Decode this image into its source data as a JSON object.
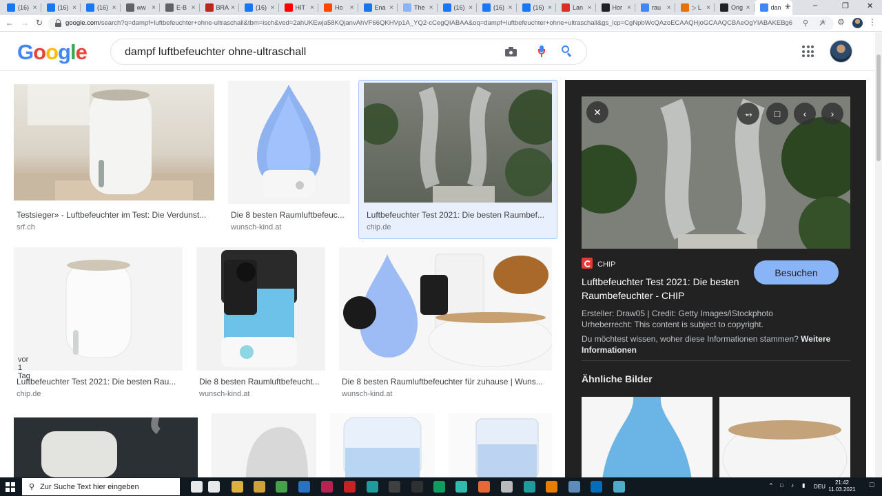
{
  "browser": {
    "tabs": [
      {
        "title": "(16)",
        "icon": "facebook-icon",
        "color": "#1877f2"
      },
      {
        "title": "(16)",
        "icon": "facebook-icon",
        "color": "#1877f2"
      },
      {
        "title": "(16)",
        "icon": "facebook-icon",
        "color": "#1877f2"
      },
      {
        "title": "ww",
        "icon": "globe-icon",
        "color": "#5f6368"
      },
      {
        "title": "E-B",
        "icon": "gear-icon",
        "color": "#5f6368"
      },
      {
        "title": "BRA",
        "icon": "brand-b-icon",
        "color": "#c5221f"
      },
      {
        "title": "(16)",
        "icon": "facebook-icon",
        "color": "#1877f2"
      },
      {
        "title": "HIT",
        "icon": "youtube-icon",
        "color": "#ff0000"
      },
      {
        "title": "Ho",
        "icon": "reddit-icon",
        "color": "#ff4500"
      },
      {
        "title": "Ena",
        "icon": "n-icon",
        "color": "#1a73e8"
      },
      {
        "title": "The",
        "icon": "doc-icon",
        "color": "#8ab4f8"
      },
      {
        "title": "(16)",
        "icon": "facebook-icon",
        "color": "#1877f2"
      },
      {
        "title": "(16)",
        "icon": "facebook-icon",
        "color": "#1877f2"
      },
      {
        "title": "(16)",
        "icon": "facebook-icon",
        "color": "#1877f2"
      },
      {
        "title": "Lan",
        "icon": "flag-icon",
        "color": "#d93025"
      },
      {
        "title": "Hor",
        "icon": "wikipedia-icon",
        "color": "#202124"
      },
      {
        "title": "rau",
        "icon": "google-icon",
        "color": "#4285f4"
      },
      {
        "title": "▷ L",
        "icon": "shield-icon",
        "color": "#e8710a"
      },
      {
        "title": "Orig",
        "icon": "amazon-icon",
        "color": "#202124"
      },
      {
        "title": "dan",
        "icon": "google-icon",
        "color": "#4285f4",
        "active": true
      }
    ],
    "new_tab": "+",
    "url_domain": "google.com",
    "url_rest": "/search?q=dampf+luftbefeuchter+ohne-ultraschall&tbm=isch&ved=2ahUKEwja58KQjanvAhVF66QKHVp1A_YQ2-cCegQIABAA&oq=dampf+luftbefeuchter+ohne+ultraschall&gs_lcp=CgNpbWcQAzoECAAQHjoGCAAQCBAeOgYIABAKEBg6BAgAEB..."
  },
  "google": {
    "logo_letters": [
      {
        "ch": "G",
        "color": "#4285f4"
      },
      {
        "ch": "o",
        "color": "#ea4335"
      },
      {
        "ch": "o",
        "color": "#fbbc05"
      },
      {
        "ch": "g",
        "color": "#4285f4"
      },
      {
        "ch": "l",
        "color": "#34a853"
      },
      {
        "ch": "e",
        "color": "#ea4335"
      }
    ],
    "query": "dampf luftbefeuchter ohne-ultraschall"
  },
  "results": [
    {
      "caption": "Testsieger» - Luftbefeuchter im Test: Die Verdunst...",
      "source": "srf.ch"
    },
    {
      "caption": "Die 8 besten Raumluftbefeuc...",
      "source": "wunsch-kind.at"
    },
    {
      "caption": "Luftbefeuchter Test 2021: Die besten Raumbef...",
      "source": "chip.de",
      "selected": true
    },
    {
      "caption": "Luftbefeuchter Test 2021: Die besten Rau...",
      "source": "chip.de",
      "badge": "vor 1 Tag"
    },
    {
      "caption": "Die 8 besten Raumluftbefeucht...",
      "source": "wunsch-kind.at"
    },
    {
      "caption": "Die 8 besten Raumluftbefeuchter für zuhause | Wuns...",
      "source": "wunsch-kind.at"
    }
  ],
  "preview": {
    "site": "CHIP",
    "title": "Luftbefeuchter Test 2021: Die besten Raumbefeuchter - CHIP",
    "visit_label": "Besuchen",
    "creator": "Ersteller: Draw05 | Credit: Getty Images/iStockphoto",
    "copyright": "Urheberrecht: This content is subject to copyright.",
    "info_question": "Du möchtest wissen, woher diese Informationen stammen?",
    "info_link": "Weitere Informationen",
    "similar_heading": "Ähnliche Bilder",
    "buttons": [
      "close-icon",
      "share-icon",
      "bookmark-icon",
      "chevron-left-icon",
      "chevron-right-icon"
    ]
  },
  "taskbar": {
    "search_placeholder": "Zur Suche Text hier eingeben",
    "language": "DEU",
    "time": "21:42",
    "date": "11.03.2021"
  }
}
